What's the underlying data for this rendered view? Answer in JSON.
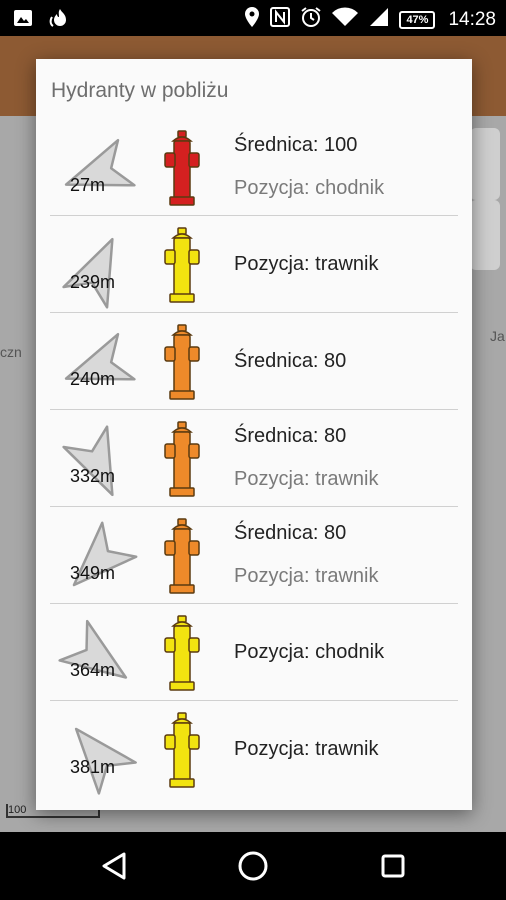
{
  "status_bar": {
    "time": "14:28",
    "battery": "47%",
    "left_icons": [
      "image-icon",
      "fire-icon"
    ],
    "right_icons": [
      "location-icon",
      "nfc-icon",
      "alarm-icon",
      "wifi-icon",
      "signal-icon"
    ]
  },
  "map": {
    "labels": [
      "czn",
      "Ja"
    ],
    "scale": "100"
  },
  "dialog": {
    "title": "Hydranty w pobliżu",
    "items": [
      {
        "distance": "27m",
        "line1": "Średnica: 100",
        "line2": "Pozycja: chodnik",
        "color": "#d42020",
        "arrow_rotation": 250
      },
      {
        "distance": "239m",
        "line1": "Pozycja: trawnik",
        "line2": "",
        "color": "#f2e310",
        "arrow_rotation": 25
      },
      {
        "distance": "240m",
        "line1": "Średnica: 80",
        "line2": "",
        "color": "#ee8a2a",
        "arrow_rotation": 250
      },
      {
        "distance": "332m",
        "line1": "Średnica: 80",
        "line2": "Pozycja: trawnik",
        "color": "#ee8a2a",
        "arrow_rotation": 155
      },
      {
        "distance": "349m",
        "line1": "Średnica: 80",
        "line2": "Pozycja: trawnik",
        "color": "#ee8a2a",
        "arrow_rotation": 225
      },
      {
        "distance": "364m",
        "line1": "Pozycja: chodnik",
        "line2": "",
        "color": "#f2e310",
        "arrow_rotation": 125
      },
      {
        "distance": "381m",
        "line1": "Pozycja: trawnik",
        "line2": "",
        "color": "#f2e310",
        "arrow_rotation": 320
      }
    ]
  },
  "nav_bar": {
    "buttons": [
      "back",
      "home",
      "recents"
    ]
  }
}
